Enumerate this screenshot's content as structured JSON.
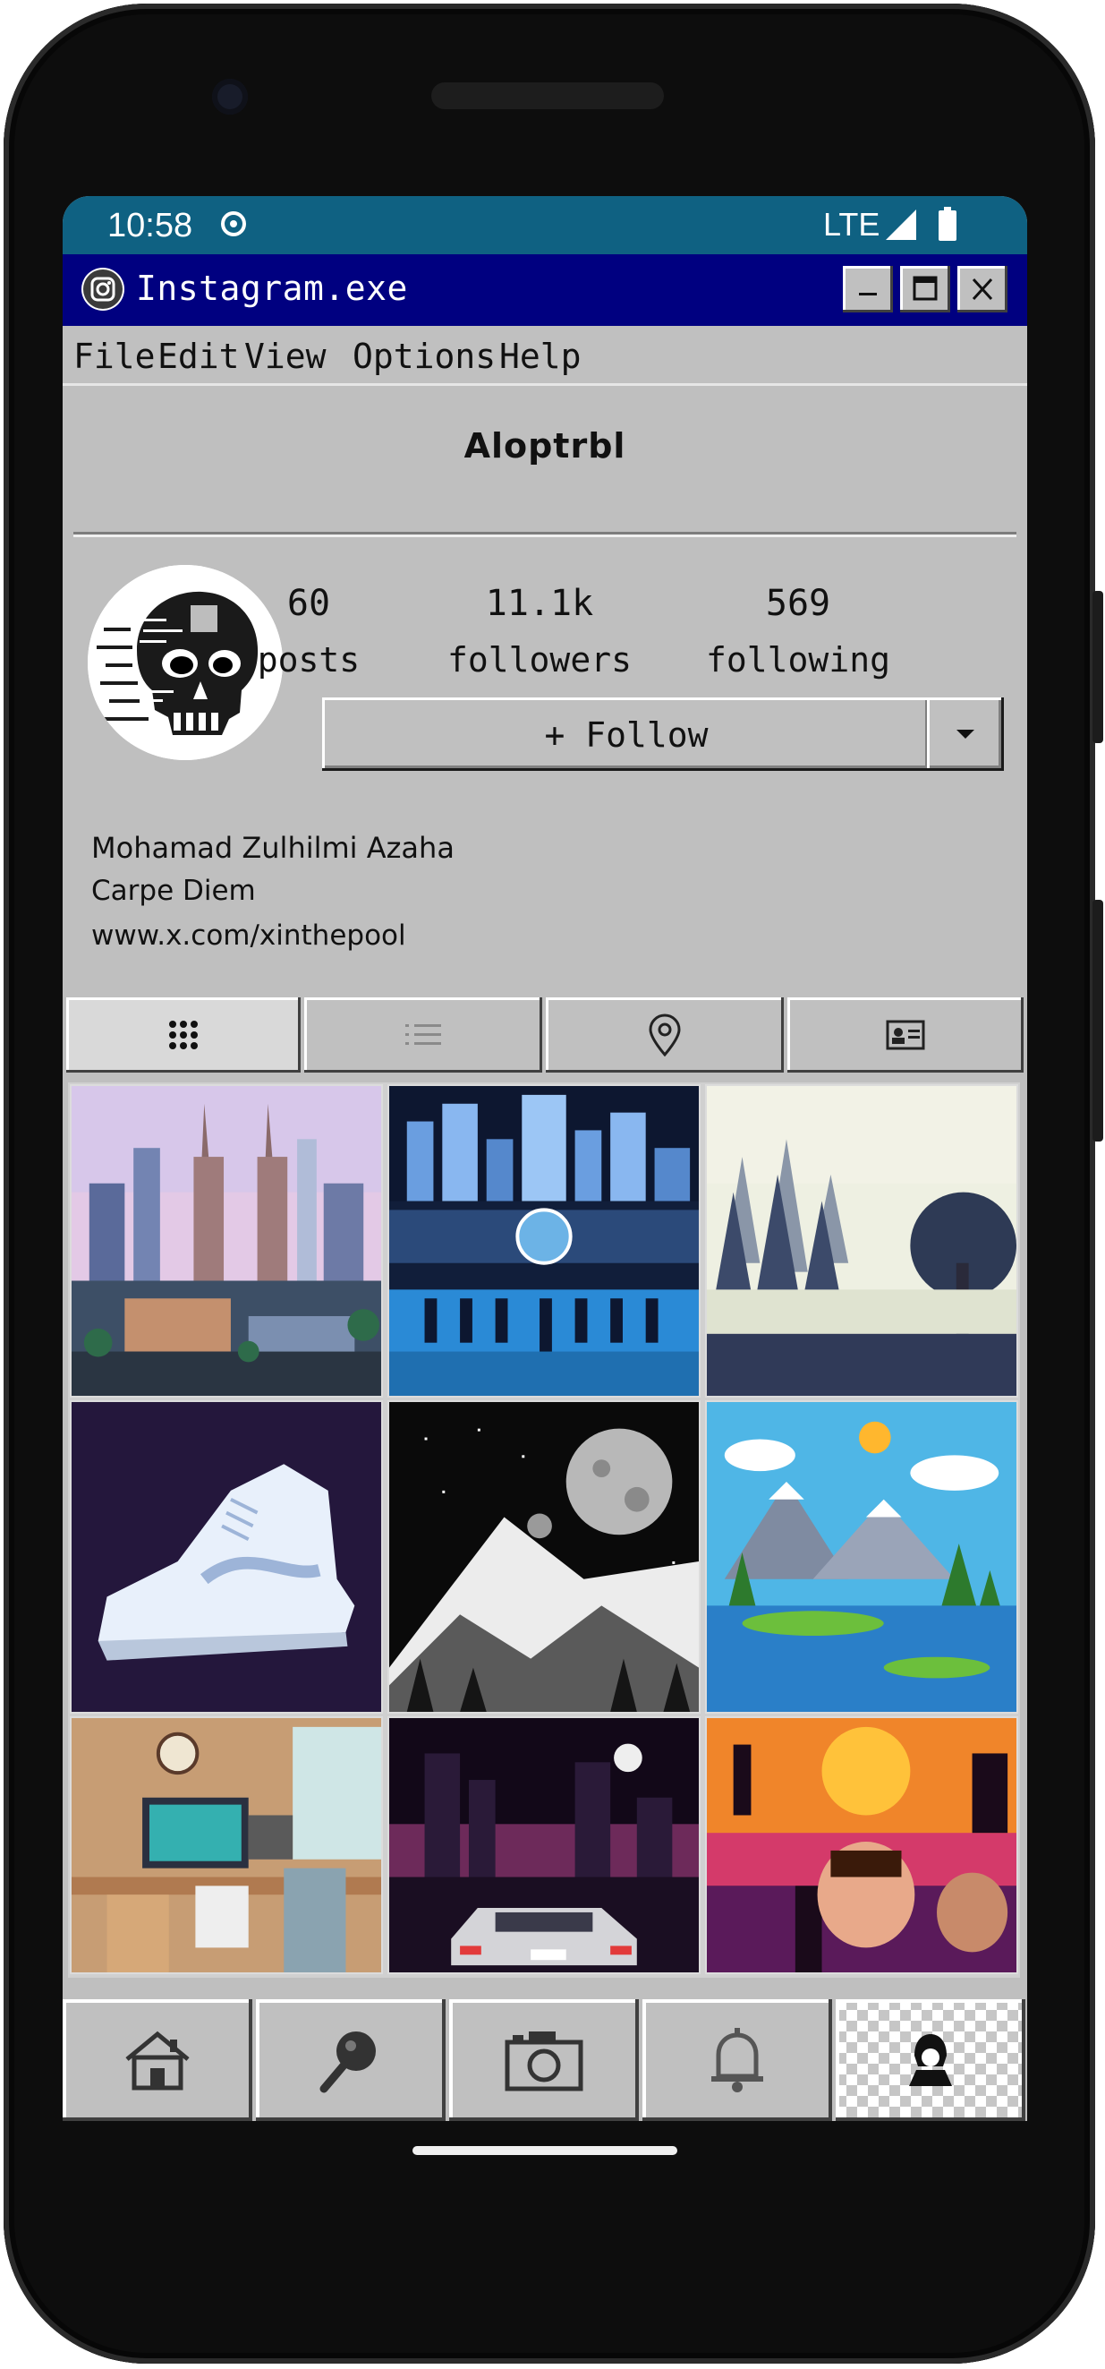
{
  "status_bar": {
    "time": "10:58",
    "network": "LTE",
    "sync_icon": "sync-icon",
    "signal_icon": "signal-icon",
    "battery_icon": "battery-icon",
    "color": "#0f6182"
  },
  "window": {
    "title": "Instagram.exe",
    "app_icon": "instagram-icon",
    "controls": [
      "minimize",
      "maximize",
      "close"
    ],
    "titlebar_color": "#000080"
  },
  "menu": {
    "items": [
      "File",
      "Edit",
      "View",
      "Options",
      "Help"
    ]
  },
  "profile": {
    "username": "Aloptrbl",
    "stats": [
      {
        "value": "60",
        "label": "posts"
      },
      {
        "value": "11.1k",
        "label": "followers"
      },
      {
        "value": "569",
        "label": "following"
      }
    ],
    "follow_label": "+ Follow",
    "name": "Mohamad Zulhilmi Azaha",
    "bio": "Carpe Diem",
    "link": "www.x.com/xinthepool"
  },
  "tabs": [
    {
      "icon": "grid-icon",
      "active": true
    },
    {
      "icon": "list-icon",
      "active": false
    },
    {
      "icon": "location-pin-icon",
      "active": false
    },
    {
      "icon": "id-card-icon",
      "active": false
    }
  ],
  "posts": [
    "pixel-city-twin-towers",
    "pixel-football-stadium",
    "pixel-misty-forest-lake",
    "pixel-white-sneaker",
    "pixel-moon-mountain",
    "pixel-colorful-landscape",
    "pixel-desk-room",
    "pixel-night-city-car",
    "pixel-retro-movie-poster"
  ],
  "bottom_nav": [
    {
      "icon": "home-icon",
      "active": false
    },
    {
      "icon": "search-icon",
      "active": false
    },
    {
      "icon": "camera-icon",
      "active": false
    },
    {
      "icon": "bell-icon",
      "active": false
    },
    {
      "icon": "profile-icon",
      "active": true
    }
  ]
}
